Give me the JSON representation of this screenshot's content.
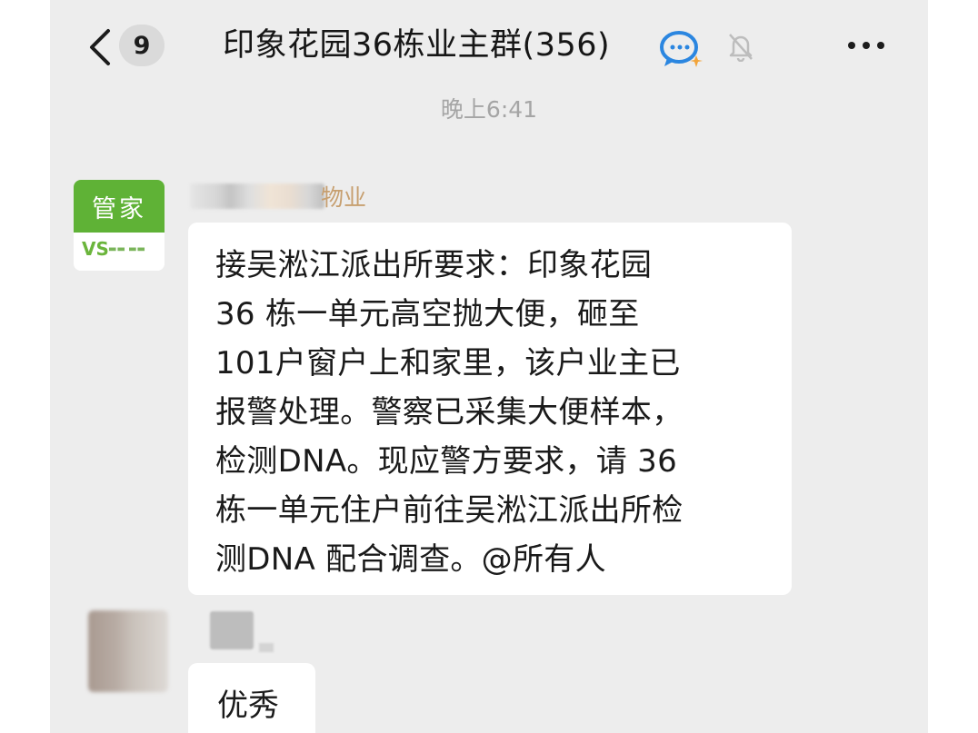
{
  "header": {
    "back_icon": "chevron-left-icon",
    "unread_count": "9",
    "title": "印象花园36栋业主群(356)",
    "group_icon": "group-chat-icon",
    "mute_icon": "bell-muted-icon",
    "more_icon": "more-dots-icon"
  },
  "timestamp": "晚上6:41",
  "messages": [
    {
      "avatar_label": "管家",
      "avatar_logo_mark": "VS",
      "sender_suffix": "物业",
      "text": "接吴淞江派出所要求：印象花园\n36 栋一单元高空抛大便，砸至\n101户窗户上和家里，该户业主已\n报警处理。警察已采集大便样本，\n检测DNA。现应警方要求，请 36\n栋一单元住户前往吴淞江派出所检\n测DNA 配合调查。@所有人"
    },
    {
      "text": "优秀"
    }
  ],
  "colors": {
    "chat_background": "#ededed",
    "bubble": "#ffffff",
    "housekeeper_green": "#5fb236",
    "sender_name": "#c79f6f",
    "timestamp": "#a5a5a5"
  }
}
